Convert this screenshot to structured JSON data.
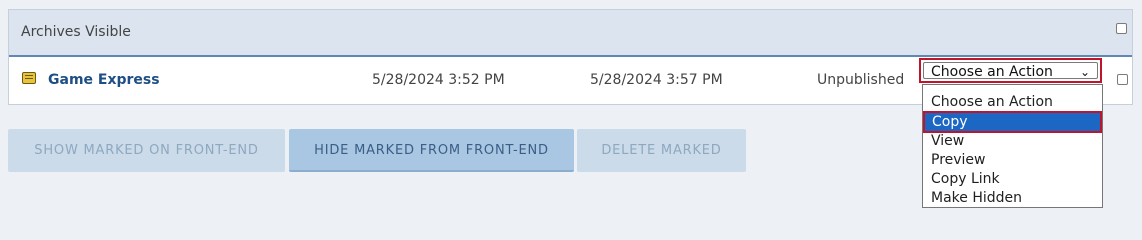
{
  "panel": {
    "title": "Archives Visible"
  },
  "row": {
    "name": "Game Express",
    "created": "5/28/2024 3:52 PM",
    "modified": "5/28/2024 3:57 PM",
    "status": "Unpublished",
    "action_select": {
      "value": "Choose an Action",
      "options": [
        "Choose an Action",
        "Copy",
        "View",
        "Preview",
        "Copy Link",
        "Make Hidden"
      ],
      "highlighted": "Copy"
    }
  },
  "buttons": {
    "show": "SHOW MARKED ON FRONT-END",
    "hide": "HIDE MARKED FROM FRONT-END",
    "delete": "DELETE MARKED"
  },
  "icons": {
    "item": "game-item-icon",
    "dropdown": "chevron-down-icon"
  },
  "colors": {
    "header_bg": "#dbe4ef",
    "header_border": "#5f88b3",
    "link": "#1e4f84",
    "highlight": "#1d67c4",
    "annotation": "#c0142b",
    "button_active": "#a9c6e3",
    "button_disabled": "#cbdbea"
  }
}
